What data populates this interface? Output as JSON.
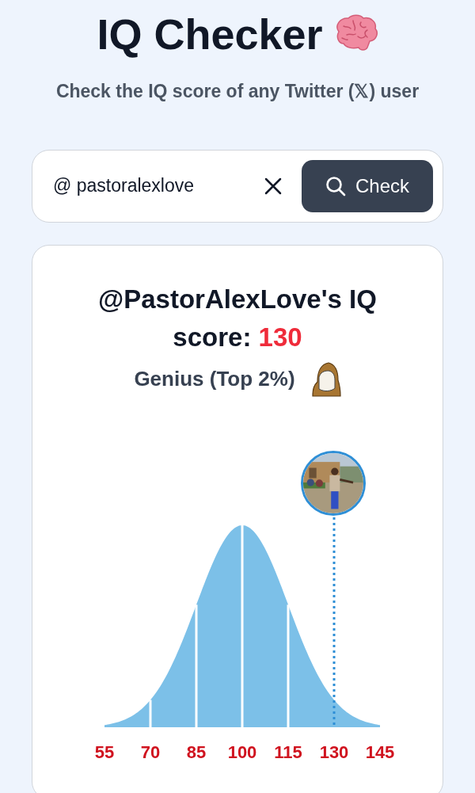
{
  "header": {
    "title": "IQ Checker",
    "subtitle": "Check the IQ score of any Twitter (𝕏) user"
  },
  "search": {
    "value": "@ pastoralexlove",
    "button": "Check"
  },
  "result": {
    "heading": "@PastorAlexLove's IQ score: ",
    "score": "130",
    "category": "Genius (Top 2%)",
    "axis_labels": [
      "55",
      "70",
      "85",
      "100",
      "115",
      "130",
      "145"
    ]
  }
}
